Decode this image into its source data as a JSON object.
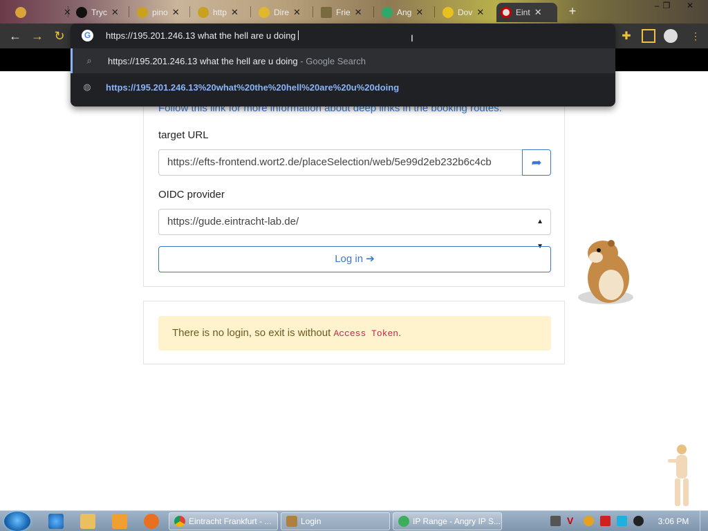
{
  "browser": {
    "tabs": [
      {
        "label": "",
        "icon": "cat-icon"
      },
      {
        "label": "Tryc",
        "icon": "face-icon"
      },
      {
        "label": "pino",
        "icon": "spiral-icon"
      },
      {
        "label": "http",
        "icon": "spiral-icon"
      },
      {
        "label": "Dire",
        "icon": "star-icon"
      },
      {
        "label": "Frie",
        "icon": "photo-icon"
      },
      {
        "label": "Ang",
        "icon": "leaf-icon"
      },
      {
        "label": "Dov",
        "icon": "smiley-icon"
      },
      {
        "label": "Eint",
        "icon": "eintracht-icon"
      }
    ],
    "new_tab": "+",
    "window_controls": {
      "minimize": "–",
      "maximize": "❐",
      "close": "✕"
    }
  },
  "omnibox": {
    "input_value": "https://195.201.246.13 what the hell are u doing",
    "suggestions": [
      {
        "text": "https://195.201.246.13 what the hell are u doing",
        "suffix": "- Google Search",
        "icon": "search-icon"
      },
      {
        "text": "https://195.201.246.13%20what%20the%20hell%20are%20u%20doing",
        "icon": "globe-icon"
      }
    ]
  },
  "page": {
    "deeplink_text": "Follow this link for more information about deep links in the booking routes.",
    "target_url_label": "target URL",
    "target_url_value": "https://efts-frontend.wort2.de/placeSelection/web/5e99d2eb232b6c4cb",
    "oidc_label": "OIDC provider",
    "oidc_value": "https://gude.eintracht-lab.de/",
    "login_label": "Log in",
    "alert_text_before": "There is no login, so exit is without ",
    "alert_code": "Access Token",
    "alert_text_after": "."
  },
  "taskbar": {
    "tasks": [
      {
        "label": "Eintracht Frankfurt - ...",
        "icon": "chrome-icon"
      },
      {
        "label": "Login",
        "icon": "login-app-icon"
      },
      {
        "label": "IP Range - Angry IP S...",
        "icon": "angry-ip-icon"
      }
    ],
    "clock": "3:06 PM"
  },
  "colors": {
    "accent_blue": "#3b78c8",
    "omnibox_bg": "#202124",
    "link_blue": "#8ab4f8",
    "alert_bg": "#fff3cd"
  }
}
